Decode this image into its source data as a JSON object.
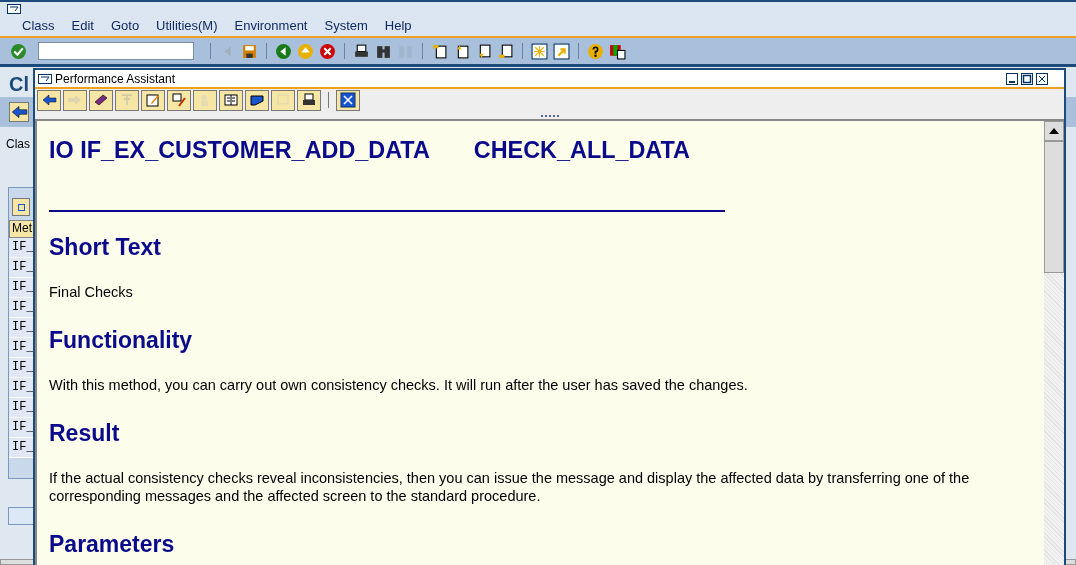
{
  "menu": [
    "Class",
    "Edit",
    "Goto",
    "Utilities(M)",
    "Environment",
    "System",
    "Help"
  ],
  "toolbar": {
    "buttons": [
      {
        "disabled": false
      },
      {
        "disabled": true
      },
      {
        "disabled": false
      },
      {
        "disabled": false
      },
      {
        "disabled": false
      },
      {
        "disabled": false
      },
      {
        "disabled": false
      },
      {
        "disabled": false
      },
      {
        "disabled": true
      },
      {
        "disabled": false
      },
      {
        "disabled": false
      },
      {
        "disabled": false
      },
      {
        "disabled": false
      },
      {
        "disabled": false
      },
      {
        "disabled": false
      },
      {
        "disabled": false
      },
      {
        "disabled": false
      }
    ]
  },
  "background": {
    "title": "Cl",
    "label": "Clas",
    "column": "Met",
    "rows": [
      "IF_",
      "IF_",
      "IF_",
      "IF_",
      "IF_",
      "IF_",
      "IF_",
      "IF_",
      "IF_",
      "IF_",
      "IF_"
    ]
  },
  "popup": {
    "title": "Performance Assistant",
    "buttons": [
      {
        "disabled": false
      },
      {
        "disabled": true
      },
      {
        "disabled": false
      },
      {
        "disabled": true
      },
      {
        "disabled": false
      },
      {
        "disabled": false
      },
      {
        "disabled": true
      },
      {
        "disabled": false
      },
      {
        "disabled": false
      },
      {
        "disabled": true
      },
      {
        "disabled": false
      },
      {
        "disabled": false
      }
    ],
    "heading": [
      "IO IF_EX_CUSTOMER_ADD_DATA",
      "CHECK_ALL_DATA"
    ],
    "sections": [
      {
        "title": "Short Text",
        "text": "Final Checks"
      },
      {
        "title": "Functionality",
        "text": "With this method, you can carry out own consistency checks. It will run after the user has saved the changes."
      },
      {
        "title": "Result",
        "text": "If the actual consistency checks reveal inconsistencies, then you can issue the message and display the affected data by transferring one of the corresponding messages and the affected screen to the standard procedure."
      },
      {
        "title": "Parameters"
      }
    ]
  }
}
